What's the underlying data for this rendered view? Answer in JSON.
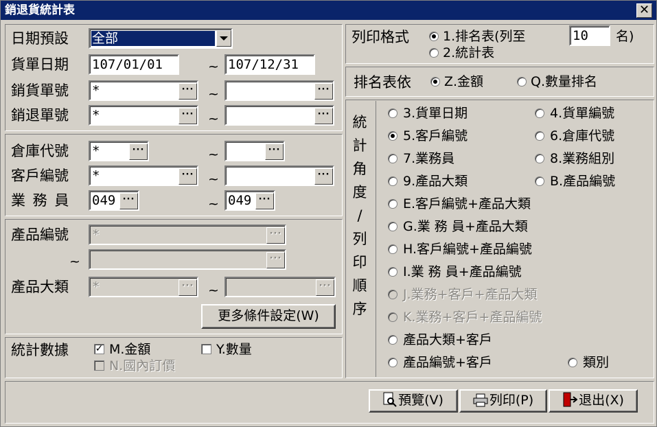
{
  "window": {
    "title": "銷退貨統計表",
    "close": "✕"
  },
  "left": {
    "date_preset_label": "日期預設",
    "date_preset_value": "全部",
    "bill_date_label": "貨單日期",
    "bill_date_from": "107/01/01",
    "bill_date_to": "107/12/31",
    "sales_no_label": "銷貨單號",
    "sales_no_from": "*",
    "sales_no_to": "",
    "return_no_label": "銷退單號",
    "return_no_from": "*",
    "return_no_to": "",
    "warehouse_label": "倉庫代號",
    "warehouse_from": "*",
    "warehouse_to": "",
    "customer_label": "客戶編號",
    "customer_from": "*",
    "customer_to": "",
    "salesman_label": "業 務 員",
    "salesman_from": "049",
    "salesman_to": "049",
    "product_no_label": "產品編號",
    "product_no_from": "*",
    "product_no_to": "",
    "product_cat_label": "產品大類",
    "product_cat_from": "*",
    "product_cat_to": "",
    "more_button": "更多條件設定(W)",
    "stats_label": "統計數據",
    "check_amount": "M.金額",
    "check_qty": "Y.數量",
    "check_domestic": "N.國內訂價",
    "tilde": "~",
    "dots": "···"
  },
  "right": {
    "print_format_label": "列印格式",
    "opt_rank": "1.排名表(列至",
    "rank_count": "10",
    "rank_suffix": "名)",
    "opt_stats": "2.統計表",
    "rank_by_label": "排名表依",
    "rank_amount": "Z.金額",
    "rank_qty": "Q.數量排名",
    "vertical_label": [
      "統",
      "計",
      "角",
      "度",
      "/",
      "列",
      "印",
      "順",
      "序"
    ],
    "options": [
      "3.貨單日期",
      "4.貨單編號",
      "5.客戶編號",
      "6.倉庫代號",
      "7.業務員",
      "8.業務組別",
      "9.產品大類",
      "B.產品編號",
      "E.客戶編號+產品大類",
      "G.業 務 員+產品大類",
      "H.客戶編號+產品編號",
      "I.業 務 員+產品編號",
      "J.業務+客戶+產品大類",
      "K.業務+客戶+產品編號",
      "產品大類+客戶",
      "產品編號+客戶",
      "類別"
    ]
  },
  "footer": {
    "preview": "預覽(V)",
    "print": "列印(P)",
    "exit": "退出(X)"
  }
}
